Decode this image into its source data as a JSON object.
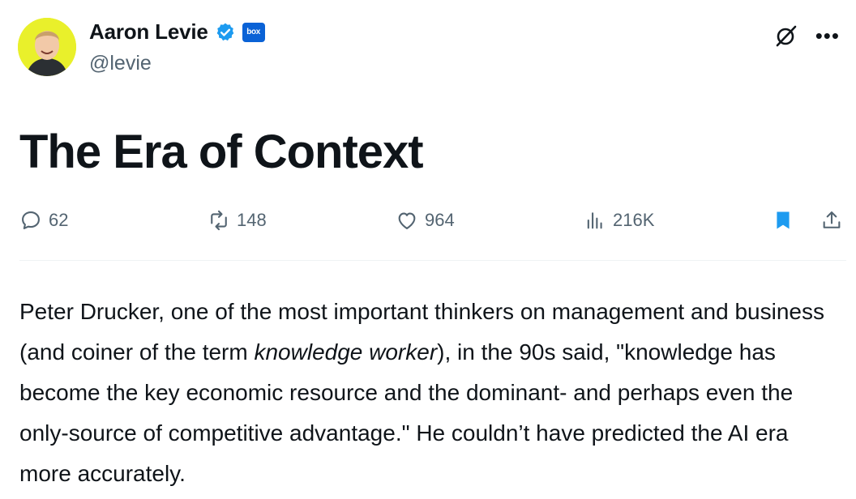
{
  "author": {
    "name": "Aaron Levie",
    "handle": "@levie",
    "affiliation_label": "box"
  },
  "article": {
    "title": "The Era of Context",
    "body_part1": "Peter Drucker, one of the most important thinkers on management and business (and coiner of the term ",
    "body_emphasis": "knowledge worker",
    "body_part2": "), in the 90s said, \"knowledge has become the key economic resource and the dominant- and perhaps even the only-source of competitive advantage.\" He couldn’t have predicted the AI era more accurately."
  },
  "stats": {
    "replies": "62",
    "reposts": "148",
    "likes": "964",
    "views": "216K"
  },
  "colors": {
    "accent": "#1d9bf0",
    "muted": "#536471",
    "text": "#0f1419",
    "avatar_bg": "#e9f02b"
  },
  "icons": [
    "verified-badge-icon",
    "grok-icon",
    "more-icon",
    "reply-icon",
    "repost-icon",
    "like-icon",
    "views-icon",
    "bookmark-icon",
    "share-icon"
  ]
}
